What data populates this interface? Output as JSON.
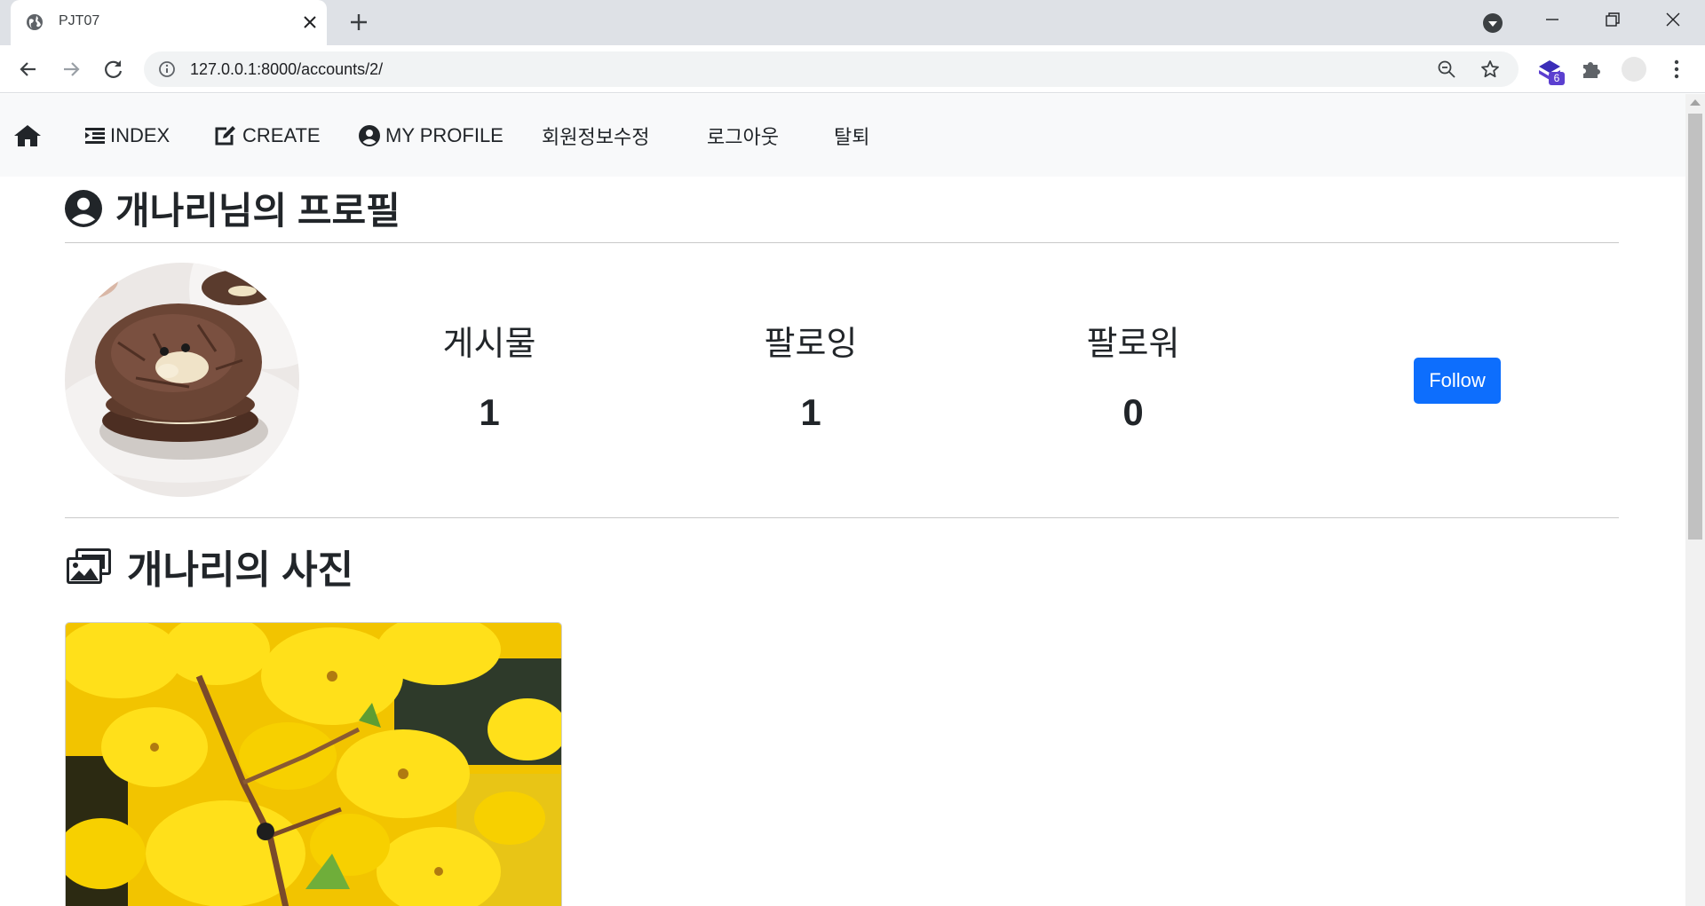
{
  "browser": {
    "tab_title": "PJT07",
    "url": "127.0.0.1:8000/accounts/2/",
    "extension_badge": "6"
  },
  "nav": {
    "home_icon": "home-icon",
    "index_label": "INDEX",
    "create_label": "CREATE",
    "profile_label": "MY PROFILE",
    "edit_account_label": "회원정보수정",
    "logout_label": "로그아웃",
    "withdraw_label": "탈퇴"
  },
  "profile": {
    "title": "개나리님의 프로필",
    "stats": [
      {
        "label": "게시물",
        "value": "1"
      },
      {
        "label": "팔로잉",
        "value": "1"
      },
      {
        "label": "팔로워",
        "value": "0"
      }
    ],
    "follow_label": "Follow"
  },
  "photos": {
    "title": "개나리의 사진"
  },
  "colors": {
    "primary": "#0d6efd",
    "nav_bg": "#f8f9fa",
    "text": "#212529"
  }
}
